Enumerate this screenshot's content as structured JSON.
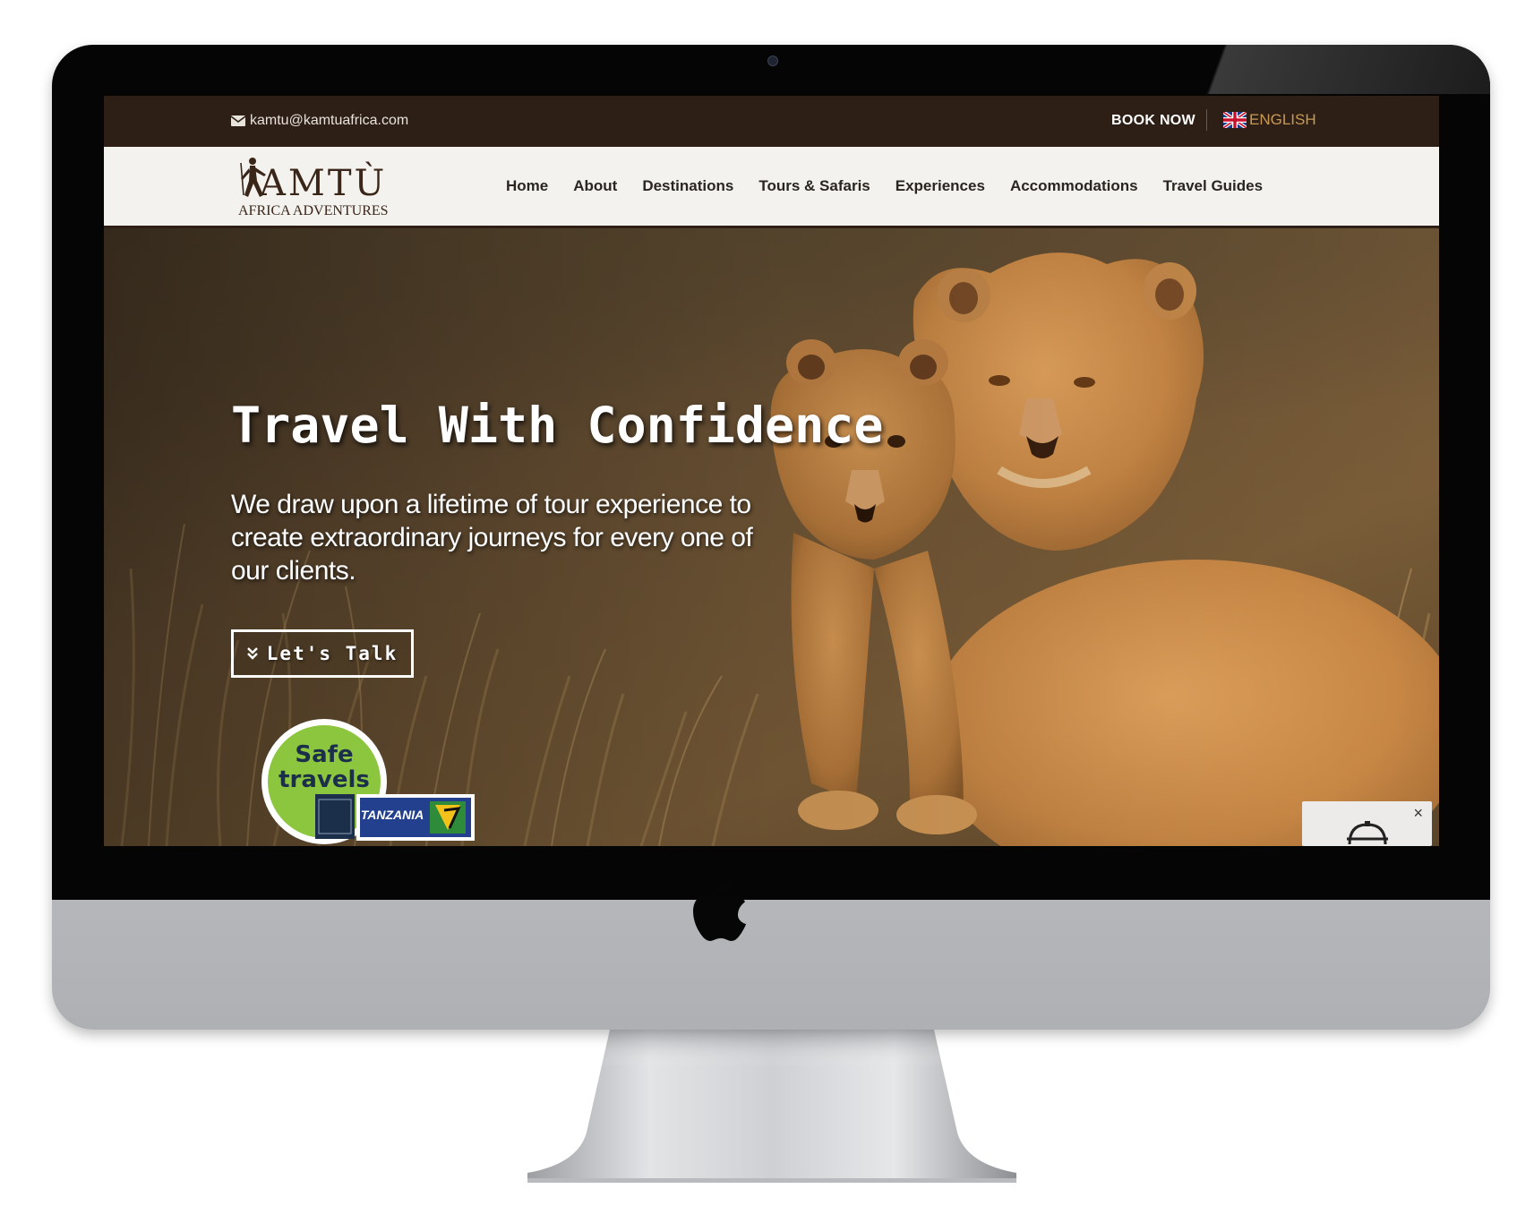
{
  "topbar": {
    "email": "kamtu@kamtuafrica.com",
    "book_now": "BOOK NOW",
    "language": "ENGLISH"
  },
  "brand": {
    "logo_name": "KAMTÙ",
    "logo_tagline": "AFRICA ADVENTURES"
  },
  "nav": {
    "items": [
      {
        "label": "Home"
      },
      {
        "label": "About"
      },
      {
        "label": "Destinations"
      },
      {
        "label": "Tours & Safaris"
      },
      {
        "label": "Experiences"
      },
      {
        "label": "Accommodations"
      },
      {
        "label": "Travel Guides"
      }
    ]
  },
  "hero": {
    "title": "Travel With Confidence",
    "subtitle": "We draw upon a lifetime of tour experience to create extraordinary journeys for every one of our clients.",
    "cta_label": "Let's Talk"
  },
  "badge": {
    "line1": "Safe",
    "line2": "travels",
    "partner": "TANZANIA"
  },
  "chat": {
    "close": "×"
  },
  "icons": {
    "email": "envelope-icon",
    "flag": "uk-flag-icon",
    "cta": "double-chevron-down-icon",
    "chat": "helmet-icon",
    "device": "apple-logo-icon"
  },
  "colors": {
    "topbar_bg": "#2d1f16",
    "navbar_bg": "#f4f2ee",
    "language_accent": "#c89a55"
  }
}
